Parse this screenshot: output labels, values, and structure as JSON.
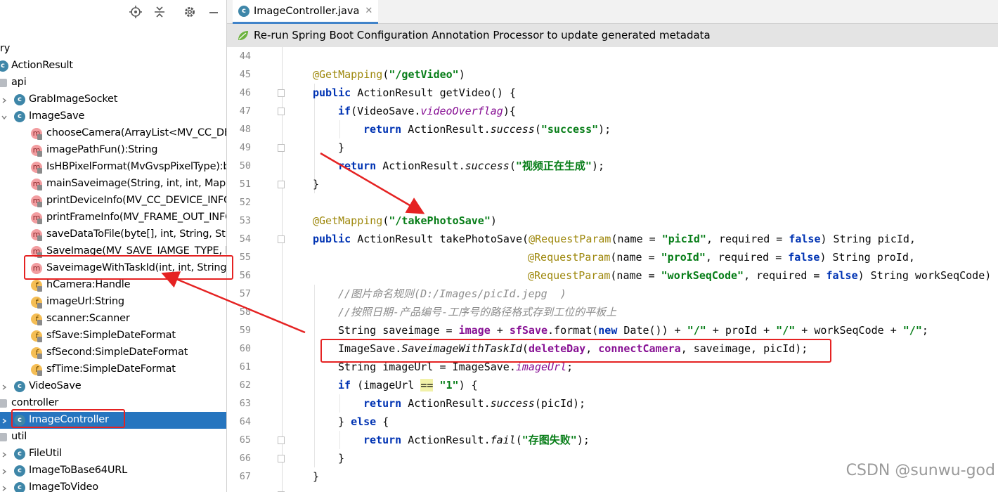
{
  "editor": {
    "tab_title": "ImageController.java",
    "notification": "Re-run Spring Boot Configuration Annotation Processor to update generated metadata",
    "line_numbers": [
      "44",
      "45",
      "46",
      "47",
      "48",
      "49",
      "50",
      "51",
      "52",
      "53",
      "54",
      "55",
      "56",
      "57",
      "58",
      "59",
      "60",
      "61",
      "62",
      "63",
      "64",
      "65",
      "66",
      "67"
    ]
  },
  "tree": {
    "items": [
      {
        "label": "ry"
      },
      {
        "label": "ActionResult"
      },
      {
        "label": "api"
      },
      {
        "label": "GrabImageSocket"
      },
      {
        "label": "ImageSave"
      },
      {
        "label": "chooseCamera(ArrayList<MV_CC_DEVI"
      },
      {
        "label": "imagePathFun():String"
      },
      {
        "label": "IsHBPixelFormat(MvGvspPixelType):bo"
      },
      {
        "label": "mainSaveimage(String, int, int, Map<S"
      },
      {
        "label": "printDeviceInfo(MV_CC_DEVICE_INFO):"
      },
      {
        "label": "printFrameInfo(MV_FRAME_OUT_INFO"
      },
      {
        "label": "saveDataToFile(byte[], int, String, Strin"
      },
      {
        "label": "SaveImage(MV_SAVE_IAMGE_TYPE, by"
      },
      {
        "label": "SaveimageWithTaskId(int, int, String, S"
      },
      {
        "label": "hCamera:Handle"
      },
      {
        "label": "imageUrl:String"
      },
      {
        "label": "scanner:Scanner"
      },
      {
        "label": "sfSave:SimpleDateFormat"
      },
      {
        "label": "sfSecond:SimpleDateFormat"
      },
      {
        "label": "sfTime:SimpleDateFormat"
      },
      {
        "label": "VideoSave"
      },
      {
        "label": "controller"
      },
      {
        "label": "ImageController"
      },
      {
        "label": "util"
      },
      {
        "label": "FileUtil"
      },
      {
        "label": "ImageToBase64URL"
      },
      {
        "label": "ImageToVideo"
      }
    ]
  },
  "code": {
    "l45": {
      "ann": "@GetMapping",
      "open": "(",
      "path": "\"/getVideo\"",
      "close": ")"
    },
    "l46": {
      "public": "public",
      "sig": " ActionResult getVideo() {"
    },
    "l47": {
      "if": "if",
      "a": "(VideoSave.",
      "field": "videoOverflag",
      "b": "){"
    },
    "l48": {
      "ret": "return",
      "a": " ActionResult.",
      "m": "success",
      "b": "(",
      "s": "\"success\"",
      "c": ");"
    },
    "l49": {
      "t": "}"
    },
    "l50": {
      "ret": "return",
      "a": " ActionResult.",
      "m": "success",
      "b": "(",
      "s": "\"视频正在生成\"",
      "c": ");"
    },
    "l51": {
      "t": "}"
    },
    "l53": {
      "ann": "@GetMapping",
      "open": "(",
      "path": "\"/takePhotoSave\"",
      "close": ")"
    },
    "l54": {
      "public": "public",
      "a": " ActionResult takePhotoSave(",
      "rp": "@RequestParam",
      "b": "(name = ",
      "s": "\"picId\"",
      "c": ", required = ",
      "f": "false",
      "d": ") String picId,"
    },
    "l55": {
      "rp": "@RequestParam",
      "b": "(name = ",
      "s": "\"proId\"",
      "c": ", required = ",
      "f": "false",
      "d": ") String proId,"
    },
    "l56": {
      "rp": "@RequestParam",
      "b": "(name = ",
      "s": "\"workSeqCode\"",
      "c": ", required = ",
      "f": "false",
      "d": ") String workSeqCode) {"
    },
    "l57": {
      "t": "//图片命名规则(D:/Images/picId.jepg  )"
    },
    "l58": {
      "t": "//按照日期-产品编号-工序号的路径格式存到工位的平板上"
    },
    "l59": {
      "a": "String saveimage = ",
      "img": "image",
      "b": " + ",
      "sf": "sfSave",
      "c": ".format(",
      "nw": "new",
      "d": " Date()) + ",
      "s1": "\"/\"",
      "e": " + proId + ",
      "s2": "\"/\"",
      "g": " + workSeqCode + ",
      "s3": "\"/\"",
      "h": ";"
    },
    "l60": {
      "a": "ImageSave.",
      "m": "SaveimageWithTaskId",
      "b": "(",
      "f1": "deleteDay",
      "c": ", ",
      "f2": "connectCamera",
      "d": ", saveimage, picId);"
    },
    "l61": {
      "a": "String imageUrl = ImageSave.",
      "field": "imageUrl",
      "b": ";"
    },
    "l62": {
      "if": "if",
      "a": " (imageUrl ",
      "eq": "==",
      "b": " ",
      "s": "\"1\"",
      "c": ") {"
    },
    "l63": {
      "ret": "return",
      "a": " ActionResult.",
      "m": "success",
      "b": "(picId);"
    },
    "l64": {
      "a": "} ",
      "els": "else",
      "b": " {"
    },
    "l65": {
      "ret": "return",
      "a": " ActionResult.",
      "m": "fail",
      "b": "(",
      "s": "\"存图失败\"",
      "c": ");"
    },
    "l66": {
      "t": "}"
    },
    "l67": {
      "t": "}"
    }
  },
  "watermark": "CSDN @sunwu-god",
  "colors": {
    "selection": "#2675bf",
    "highlight_box": "#e52222",
    "keyword": "#0033b3",
    "string": "#067d17",
    "annotation": "#9e880d",
    "static_field": "#871094"
  }
}
